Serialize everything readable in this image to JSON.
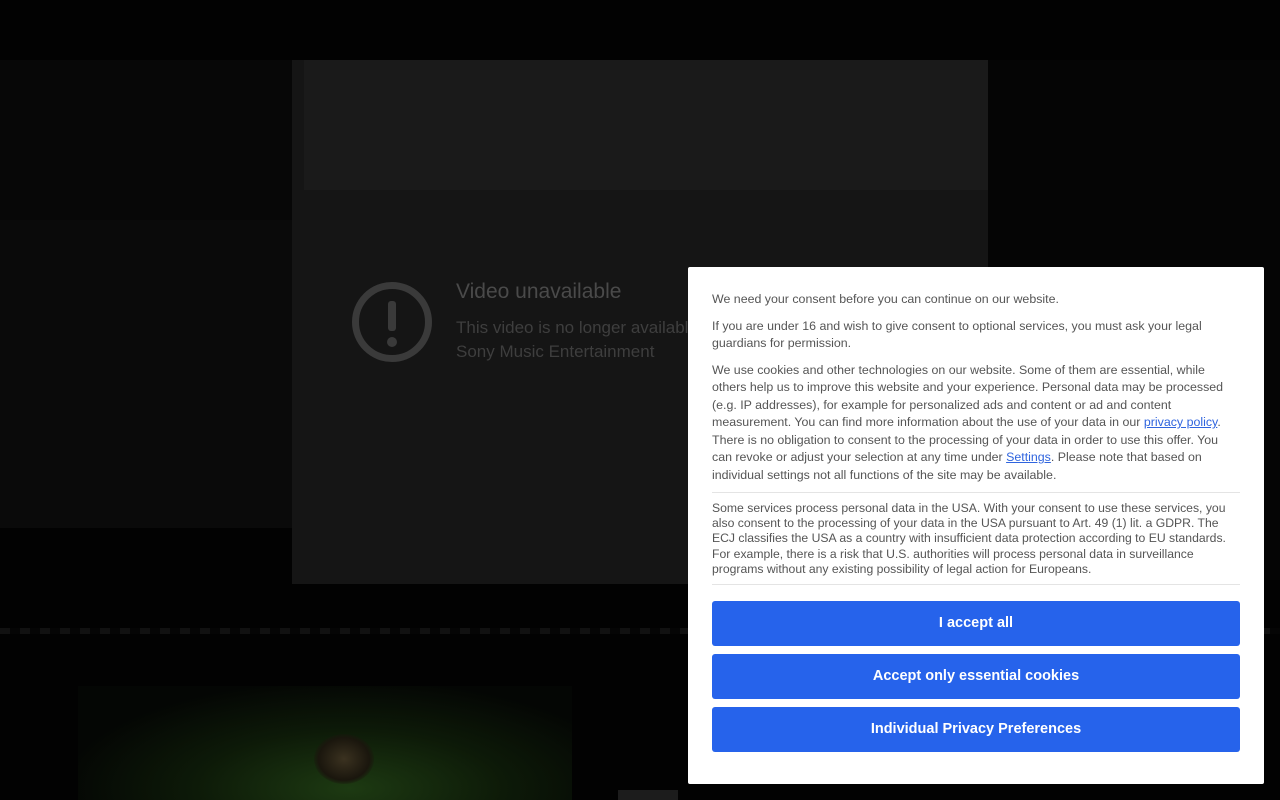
{
  "video": {
    "title": "Video unavailable",
    "message_line1": "This video is no longer available",
    "message_line2": "Sony Music Entertainment",
    "icon": "alert-circle-icon"
  },
  "consent": {
    "intro": "We need your consent before you can continue on our website.",
    "under16": "If you are under 16 and wish to give consent to optional services, you must ask your legal guardians for permission.",
    "cookies_part1": "We use cookies and other technologies on our website. Some of them are essential, while others help us to improve this website and your experience. Personal data may be processed (e.g. IP addresses), for example for personalized ads and content or ad and content measurement. You can find more information about the use of your data in our ",
    "privacy_link": "privacy policy",
    "cookies_part2": ". There is no obligation to consent to the processing of your data in order to use this offer. You can revoke or adjust your selection at any time under ",
    "settings_link": "Settings",
    "cookies_part3": ". Please note that based on individual settings not all functions of the site may be available.",
    "usa_notice": "Some services process personal data in the USA. With your consent to use these services, you also consent to the processing of your data in the USA pursuant to Art. 49 (1) lit. a GDPR. The ECJ classifies the USA as a country with insufficient data protection according to EU standards. For example, there is a risk that U.S. authorities will process personal data in surveillance programs without any existing possibility of legal action for Europeans.",
    "buttons": {
      "accept_all": "I accept all",
      "essential_only": "Accept only essential cookies",
      "preferences": "Individual Privacy Preferences"
    },
    "colors": {
      "button": "#2663eb",
      "link": "#2f64de"
    }
  }
}
